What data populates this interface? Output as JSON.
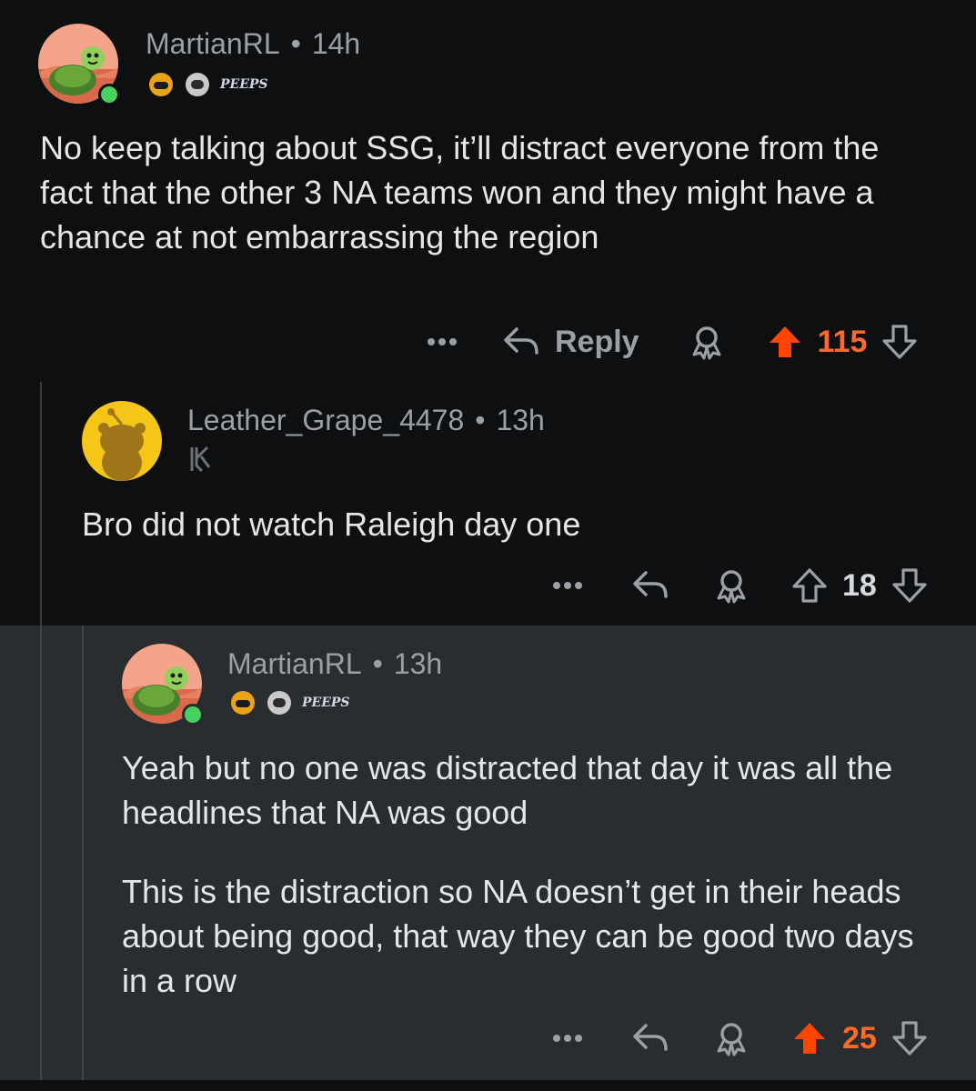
{
  "comments": [
    {
      "author": "MartianRL",
      "time": "14h",
      "flair_badges": [
        "helmet-badge",
        "astronaut-badge"
      ],
      "flair_text": "PEEPS",
      "body": [
        "No keep talking about SSG, it’ll distract everyone from the fact that the other 3 NA teams won and they might have a chance at not embarrassing the region"
      ],
      "reply_label": "Reply",
      "score": "115",
      "upvoted": true
    },
    {
      "author": "Leather_Grape_4478",
      "time": "13h",
      "flair_badges": [
        "team-logo-badge"
      ],
      "body": [
        "Bro did not watch Raleigh day one"
      ],
      "score": "18",
      "upvoted": false
    },
    {
      "author": "MartianRL",
      "time": "13h",
      "flair_badges": [
        "helmet-badge",
        "astronaut-badge"
      ],
      "flair_text": "PEEPS",
      "body": [
        "Yeah but no one was distracted that day it was all the headlines that NA was good",
        "This is the distraction so NA doesn’t get in their heads about being good, that way they can be good two days in a row"
      ],
      "score": "25",
      "upvoted": true
    }
  ],
  "colors": {
    "background": "#0e0f10",
    "highlight_background": "#2a2d30",
    "upvote_active": "#ff4500",
    "score_active": "#ff6a2b",
    "meta_text": "#9aa0a6",
    "online": "#46d160"
  },
  "icons": [
    "more-icon",
    "reply-icon",
    "award-icon",
    "upvote-icon",
    "downvote-icon"
  ]
}
